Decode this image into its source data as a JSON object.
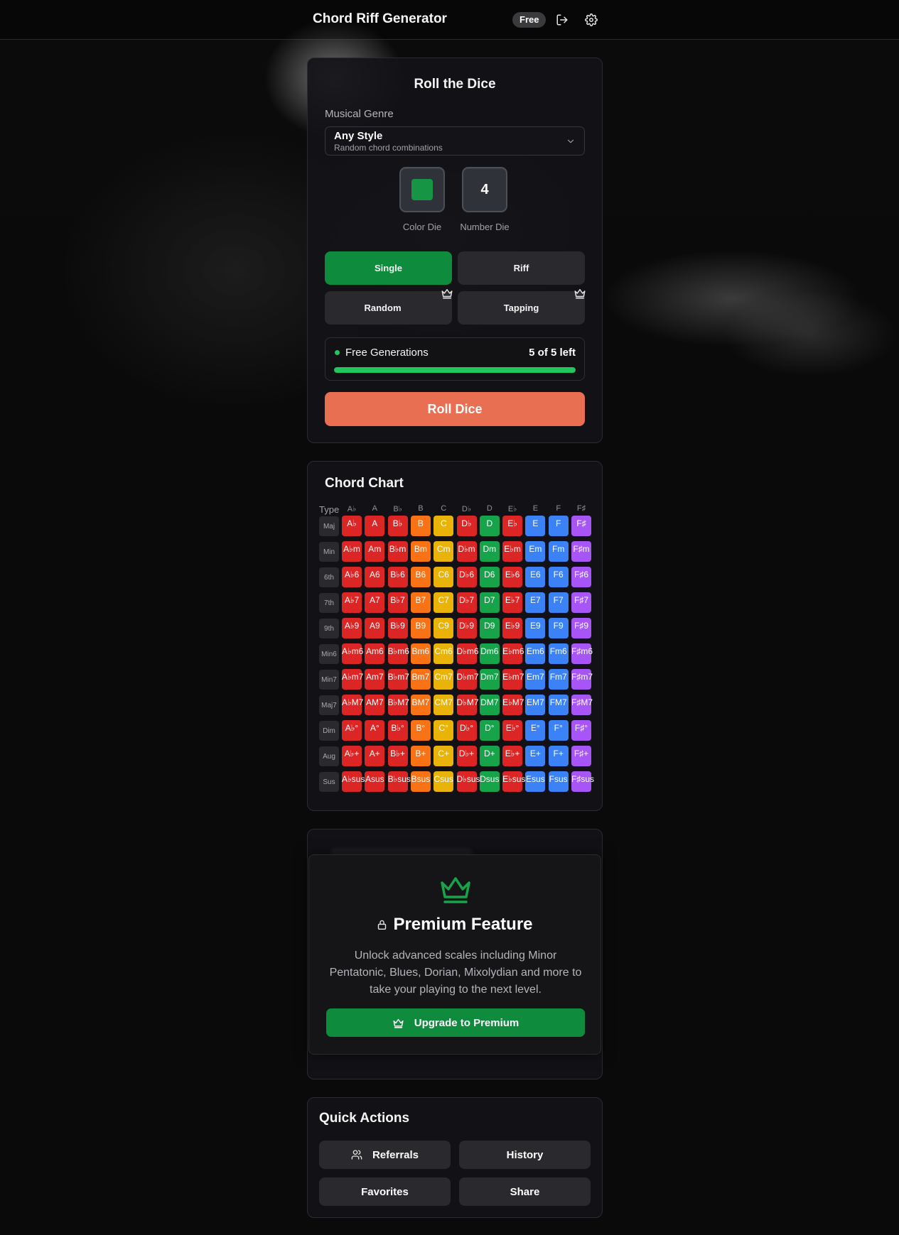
{
  "header": {
    "title": "Chord Riff Generator",
    "plan_badge": "Free",
    "icons": [
      "logout-icon",
      "settings-icon"
    ]
  },
  "roll": {
    "title": "Roll the Dice",
    "genre_label": "Musical Genre",
    "genre_value": "Any Style",
    "genre_description": "Random chord combinations",
    "color_die_label": "Color Die",
    "color_die_color": "#169545",
    "number_die_value": "4",
    "number_die_label": "Number Die",
    "modes": [
      {
        "label": "Single",
        "active": true,
        "premium": false
      },
      {
        "label": "Riff",
        "active": false,
        "premium": false
      },
      {
        "label": "Random",
        "active": false,
        "premium": true
      },
      {
        "label": "Tapping",
        "active": false,
        "premium": true
      }
    ],
    "free_generations_label": "Free Generations",
    "free_generations_count": "5 of 5 left",
    "free_generations_fraction": 1.0,
    "roll_button": "Roll Dice"
  },
  "chart": {
    "title": "Chord Chart",
    "type_header": "Type",
    "roots": [
      "A♭",
      "A",
      "B♭",
      "B",
      "C",
      "D♭",
      "D",
      "E♭",
      "E",
      "F",
      "F♯"
    ],
    "root_colors": [
      "#dc2626",
      "#dc2626",
      "#dc2626",
      "#f97316",
      "#eab308",
      "#dc2626",
      "#16a34a",
      "#dc2626",
      "#3b82f6",
      "#3b82f6",
      "#a855f7"
    ],
    "rows": [
      {
        "type": "Maj",
        "cells": [
          "A♭",
          "A",
          "B♭",
          "B",
          "C",
          "D♭",
          "D",
          "E♭",
          "E",
          "F",
          "F♯"
        ]
      },
      {
        "type": "Min",
        "cells": [
          "A♭m",
          "Am",
          "B♭m",
          "Bm",
          "Cm",
          "D♭m",
          "Dm",
          "E♭m",
          "Em",
          "Fm",
          "F♯m"
        ]
      },
      {
        "type": "6th",
        "cells": [
          "A♭6",
          "A6",
          "B♭6",
          "B6",
          "C6",
          "D♭6",
          "D6",
          "E♭6",
          "E6",
          "F6",
          "F♯6"
        ]
      },
      {
        "type": "7th",
        "cells": [
          "A♭7",
          "A7",
          "B♭7",
          "B7",
          "C7",
          "D♭7",
          "D7",
          "E♭7",
          "E7",
          "F7",
          "F♯7"
        ]
      },
      {
        "type": "9th",
        "cells": [
          "A♭9",
          "A9",
          "B♭9",
          "B9",
          "C9",
          "D♭9",
          "D9",
          "E♭9",
          "E9",
          "F9",
          "F♯9"
        ]
      },
      {
        "type": "Min6",
        "cells": [
          "A♭m6",
          "Am6",
          "B♭m6",
          "Bm6",
          "Cm6",
          "D♭m6",
          "Dm6",
          "E♭m6",
          "Em6",
          "Fm6",
          "F♯m6"
        ]
      },
      {
        "type": "Min7",
        "cells": [
          "A♭m7",
          "Am7",
          "B♭m7",
          "Bm7",
          "Cm7",
          "D♭m7",
          "Dm7",
          "E♭m7",
          "Em7",
          "Fm7",
          "F♯m7"
        ]
      },
      {
        "type": "Maj7",
        "cells": [
          "A♭M7",
          "AM7",
          "B♭M7",
          "BM7",
          "CM7",
          "D♭M7",
          "DM7",
          "E♭M7",
          "EM7",
          "FM7",
          "F♯M7"
        ]
      },
      {
        "type": "Dim",
        "cells": [
          "A♭°",
          "A°",
          "B♭°",
          "B°",
          "C°",
          "D♭°",
          "D°",
          "E♭°",
          "E°",
          "F°",
          "F♯°"
        ]
      },
      {
        "type": "Aug",
        "cells": [
          "A♭+",
          "A+",
          "B♭+",
          "B+",
          "C+",
          "D♭+",
          "D+",
          "E♭+",
          "E+",
          "F+",
          "F♯+"
        ]
      },
      {
        "type": "Sus",
        "cells": [
          "A♭sus",
          "Asus",
          "B♭sus",
          "Bsus",
          "Csus",
          "D♭sus",
          "Dsus",
          "E♭sus",
          "Esus",
          "Fsus",
          "F♯sus"
        ]
      }
    ]
  },
  "premium": {
    "title": "Premium Feature",
    "description": "Unlock advanced scales including Minor Pentatonic, Blues, Dorian, Mixolydian and more to take your playing to the next level.",
    "button": "Upgrade to Premium",
    "accent": "#0f8b3d"
  },
  "quick_actions": {
    "title": "Quick Actions",
    "buttons": [
      {
        "label": "Referrals",
        "icon": "users-icon"
      },
      {
        "label": "History",
        "icon": ""
      },
      {
        "label": "Favorites",
        "icon": ""
      },
      {
        "label": "Share",
        "icon": ""
      }
    ]
  }
}
